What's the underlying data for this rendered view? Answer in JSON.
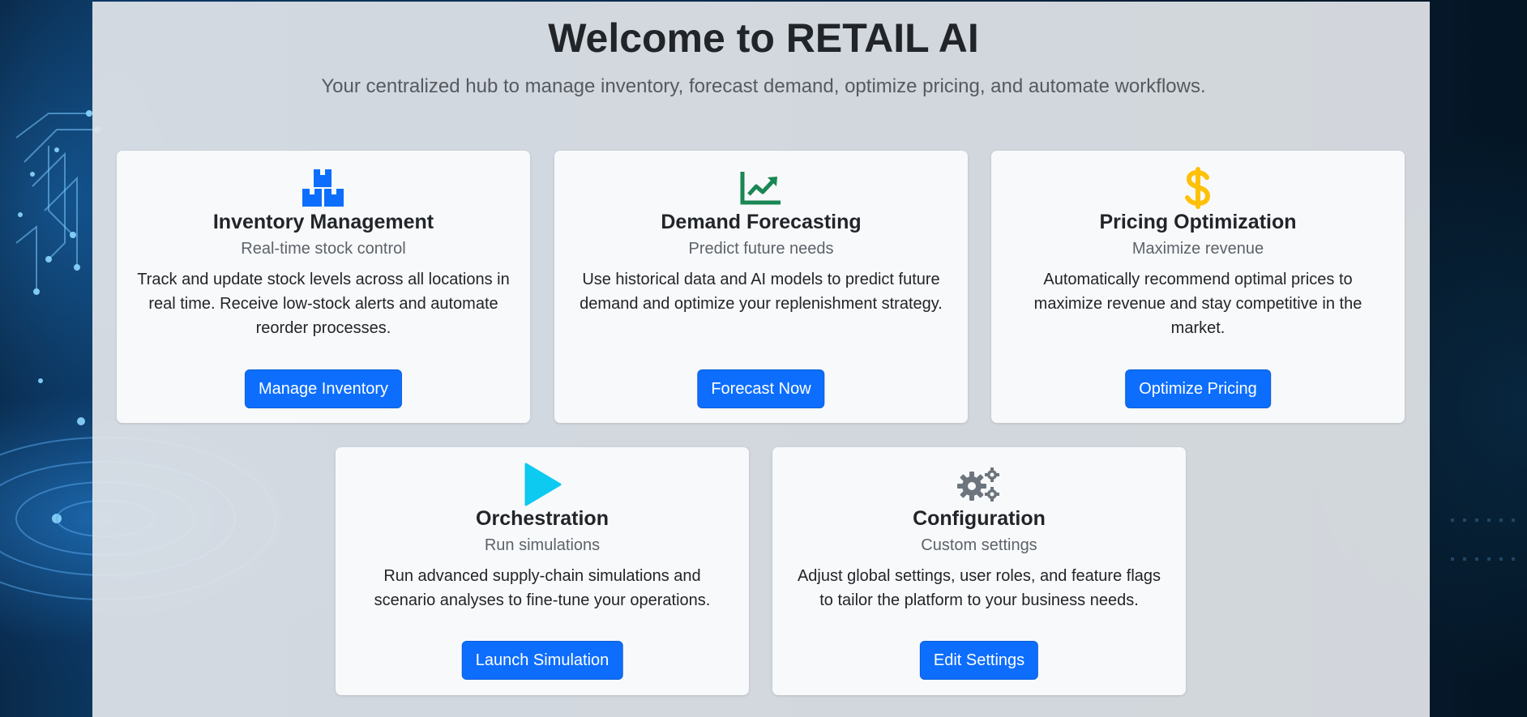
{
  "header": {
    "title": "Welcome to RETAIL AI",
    "subtitle": "Your centralized hub to manage inventory, forecast demand, optimize pricing, and automate workflows."
  },
  "cards": [
    {
      "icon": "boxes-icon",
      "icon_color": "#0d6efd",
      "title": "Inventory Management",
      "subtitle": "Real-time stock control",
      "description": "Track and update stock levels across all locations in real time. Receive low-stock alerts and automate reorder processes.",
      "button": "Manage Inventory"
    },
    {
      "icon": "graph-up-arrow-icon",
      "icon_color": "#198754",
      "title": "Demand Forecasting",
      "subtitle": "Predict future needs",
      "description": "Use historical data and AI models to predict future demand and optimize your replenishment strategy.",
      "button": "Forecast Now"
    },
    {
      "icon": "dollar-sign-icon",
      "icon_color": "#ffc107",
      "title": "Pricing Optimization",
      "subtitle": "Maximize revenue",
      "description": "Automatically recommend optimal prices to maximize revenue and stay competitive in the market.",
      "button": "Optimize Pricing"
    },
    {
      "icon": "play-icon",
      "icon_color": "#0dcaf0",
      "title": "Orchestration",
      "subtitle": "Run simulations",
      "description": "Run advanced supply-chain simulations and scenario analyses to fine-tune your operations.",
      "button": "Launch Simulation"
    },
    {
      "icon": "gears-icon",
      "icon_color": "#6c757d",
      "title": "Configuration",
      "subtitle": "Custom settings",
      "description": "Adjust global settings, user roles, and feature flags to tailor the platform to your business needs.",
      "button": "Edit Settings"
    }
  ]
}
